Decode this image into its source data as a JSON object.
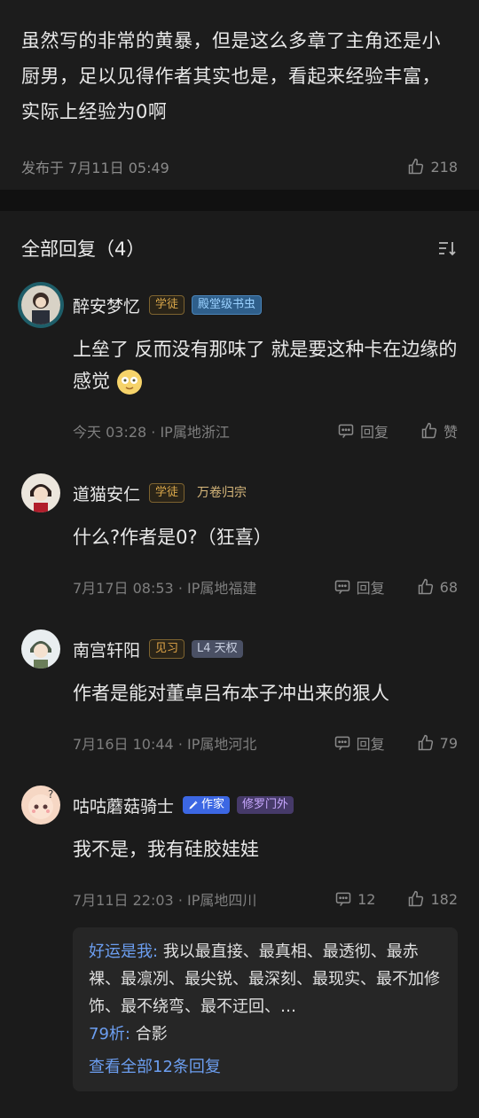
{
  "post": {
    "text": "虽然写的非常的黄暴，但是这么多章了主角还是小厨男，足以见得作者其实也是，看起来经验丰富，实际上经验为0啊",
    "time": "发布于 7月11日 05:49",
    "likes": "218"
  },
  "replies": {
    "title": "全部回复（4）",
    "items": [
      {
        "name": "醉安梦忆",
        "badge1": "学徒",
        "badge2": "殿堂级书虫",
        "text": "上垒了 反而没有那味了 就是要这种卡在边缘的感觉",
        "meta": "今天 03:28 · IP属地浙江",
        "reply_label": "回复",
        "like_label": "赞"
      },
      {
        "name": "道猫安仁",
        "badge1": "学徒",
        "badge2": "万卷归宗",
        "text": "什么?作者是0?（狂喜）",
        "meta": "7月17日 08:53 · IP属地福建",
        "reply_label": "回复",
        "like_label": "68"
      },
      {
        "name": "南宫轩阳",
        "badge1": "见习",
        "badge2": "L4 天权",
        "text": "作者是能对董卓吕布本子冲出来的狠人",
        "meta": "7月16日 10:44 · IP属地河北",
        "reply_label": "回复",
        "like_label": "79"
      },
      {
        "name": "咕咕蘑菇骑士",
        "badge1": "作家",
        "badge2": "修罗门外",
        "text": "我不是，我有硅胶娃娃",
        "meta": "7月11日 22:03 · IP属地四川",
        "reply_label": "12",
        "like_label": "182",
        "sub": {
          "r1_name": "好运是我:",
          "r1_text": "我以最直接、最真相、最透彻、最赤裸、最凛冽、最尖锐、最深刻、最现实、最不加修饰、最不绕弯、最不迂回、…",
          "r2_name": "79析:",
          "r2_text": "合影",
          "more": "查看全部12条回复"
        }
      }
    ]
  },
  "colors": {
    "background": "#171717",
    "link_blue": "#6c9ef0",
    "author_badge": "#3c67e3"
  },
  "icons": [
    "thumb-up-icon",
    "comment-icon",
    "sort-icon",
    "pen-icon"
  ]
}
